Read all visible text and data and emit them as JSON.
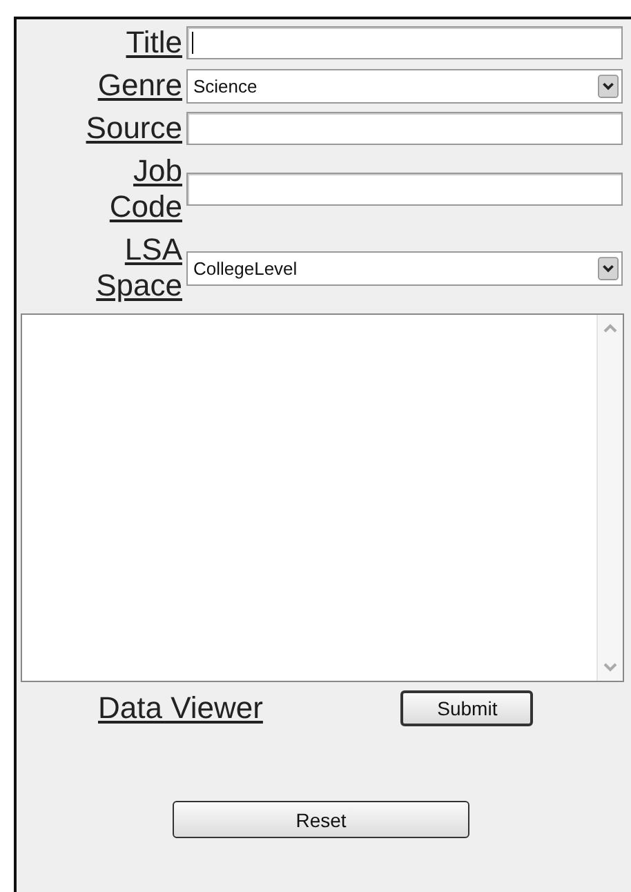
{
  "fields": [
    {
      "kind": "text",
      "label": "Title",
      "focused": true
    },
    {
      "kind": "select",
      "label": "Genre",
      "value": "Science"
    },
    {
      "kind": "text",
      "label": "Source",
      "focused": false
    },
    {
      "kind": "text",
      "label": "Job Code",
      "focused": false
    },
    {
      "kind": "select",
      "label": "LSA Space",
      "value": "CollegeLevel"
    }
  ],
  "data_viewer_link": "Data Viewer",
  "submit_button": "Submit",
  "reset_button": "Reset"
}
